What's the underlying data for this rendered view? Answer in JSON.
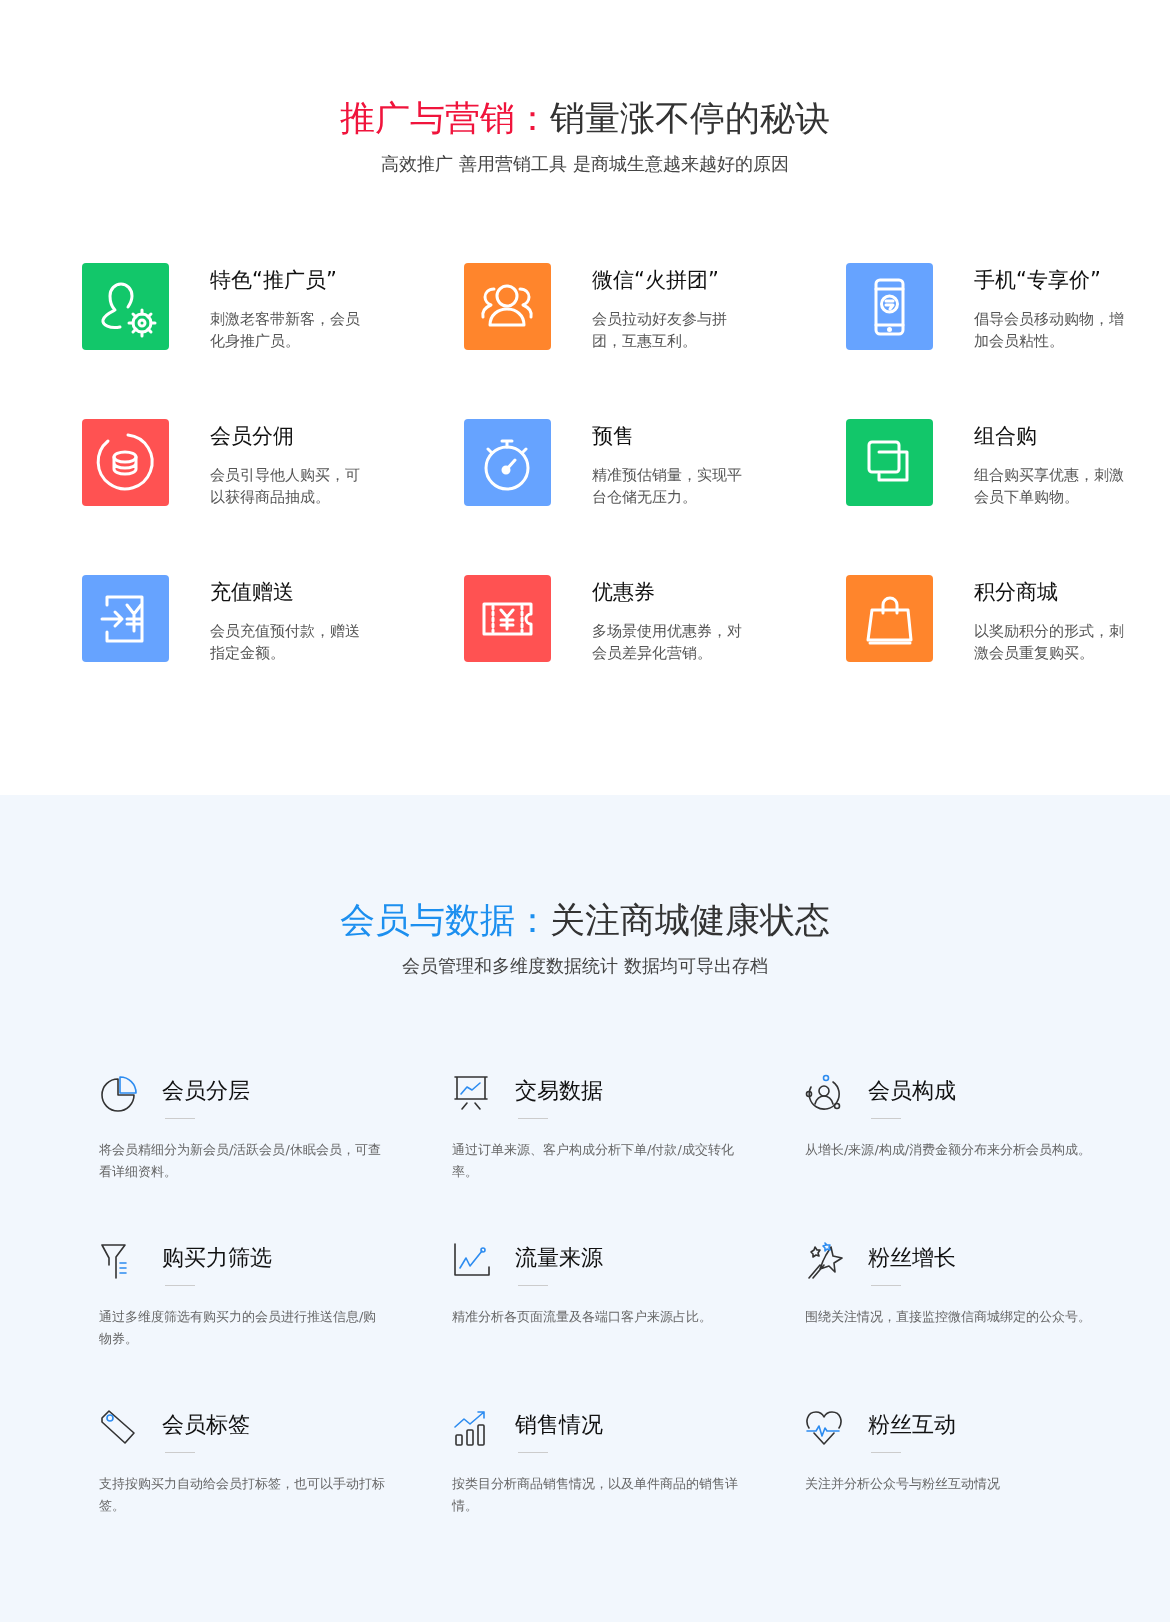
{
  "promo": {
    "heading_accent": "推广与营销：",
    "heading": "销量涨不停的秘诀",
    "subtitle": "高效推广 善用营销工具 是商城生意越来越好的原因",
    "features": [
      {
        "title": "特色“推广员”",
        "desc": "刺激老客带新客，会员化身推广员。",
        "color": "#12c76a"
      },
      {
        "title": "微信“火拼团”",
        "desc": "会员拉动好友参与拼团，互惠互利。",
        "color": "#ff852c"
      },
      {
        "title": "手机“专享价”",
        "desc": "倡导会员移动购物，增加会员粘性。",
        "color": "#66a3ff"
      },
      {
        "title": "会员分佣",
        "desc": "会员引导他人购买，可以获得商品抽成。",
        "color": "#ff5252"
      },
      {
        "title": "预售",
        "desc": "精准预估销量，实现平台仓储无压力。",
        "color": "#66a3ff"
      },
      {
        "title": "组合购",
        "desc": "组合购买享优惠，刺激会员下单购物。",
        "color": "#12c76a"
      },
      {
        "title": "充值赠送",
        "desc": "会员充值预付款，赠送指定金额。",
        "color": "#66a3ff"
      },
      {
        "title": "优惠券",
        "desc": "多场景使用优惠券，对会员差异化营销。",
        "color": "#ff5252"
      },
      {
        "title": "积分商城",
        "desc": "以奖励积分的形式，刺激会员重复购买。",
        "color": "#ff852c"
      }
    ]
  },
  "members": {
    "heading_accent": "会员与数据：",
    "heading": "关注商城健康状态",
    "subtitle": "会员管理和多维度数据统计 数据均可导出存档",
    "items": [
      {
        "title": "会员分层",
        "desc": "将会员精细分为新会员/活跃会员/休眠会员，可查看详细资料。"
      },
      {
        "title": "交易数据",
        "desc": "通过订单来源、客户构成分析下单/付款/成交转化率。"
      },
      {
        "title": "会员构成",
        "desc": "从增长/来源/构成/消费金额分布来分析会员构成。"
      },
      {
        "title": "购买力筛选",
        "desc": "通过多维度筛选有购买力的会员进行推送信息/购物券。"
      },
      {
        "title": "流量来源",
        "desc": "精准分析各页面流量及各端口客户来源占比。"
      },
      {
        "title": "粉丝增长",
        "desc": "围绕关注情况，直接监控微信商城绑定的公众号。"
      },
      {
        "title": "会员标签",
        "desc": "支持按购买力自动给会员打标签，也可以手动打标签。"
      },
      {
        "title": "销售情况",
        "desc": "按类目分析商品销售情况，以及单件商品的销售详情。"
      },
      {
        "title": "粉丝互动",
        "desc": "关注并分析公众号与粉丝互动情况"
      }
    ]
  }
}
